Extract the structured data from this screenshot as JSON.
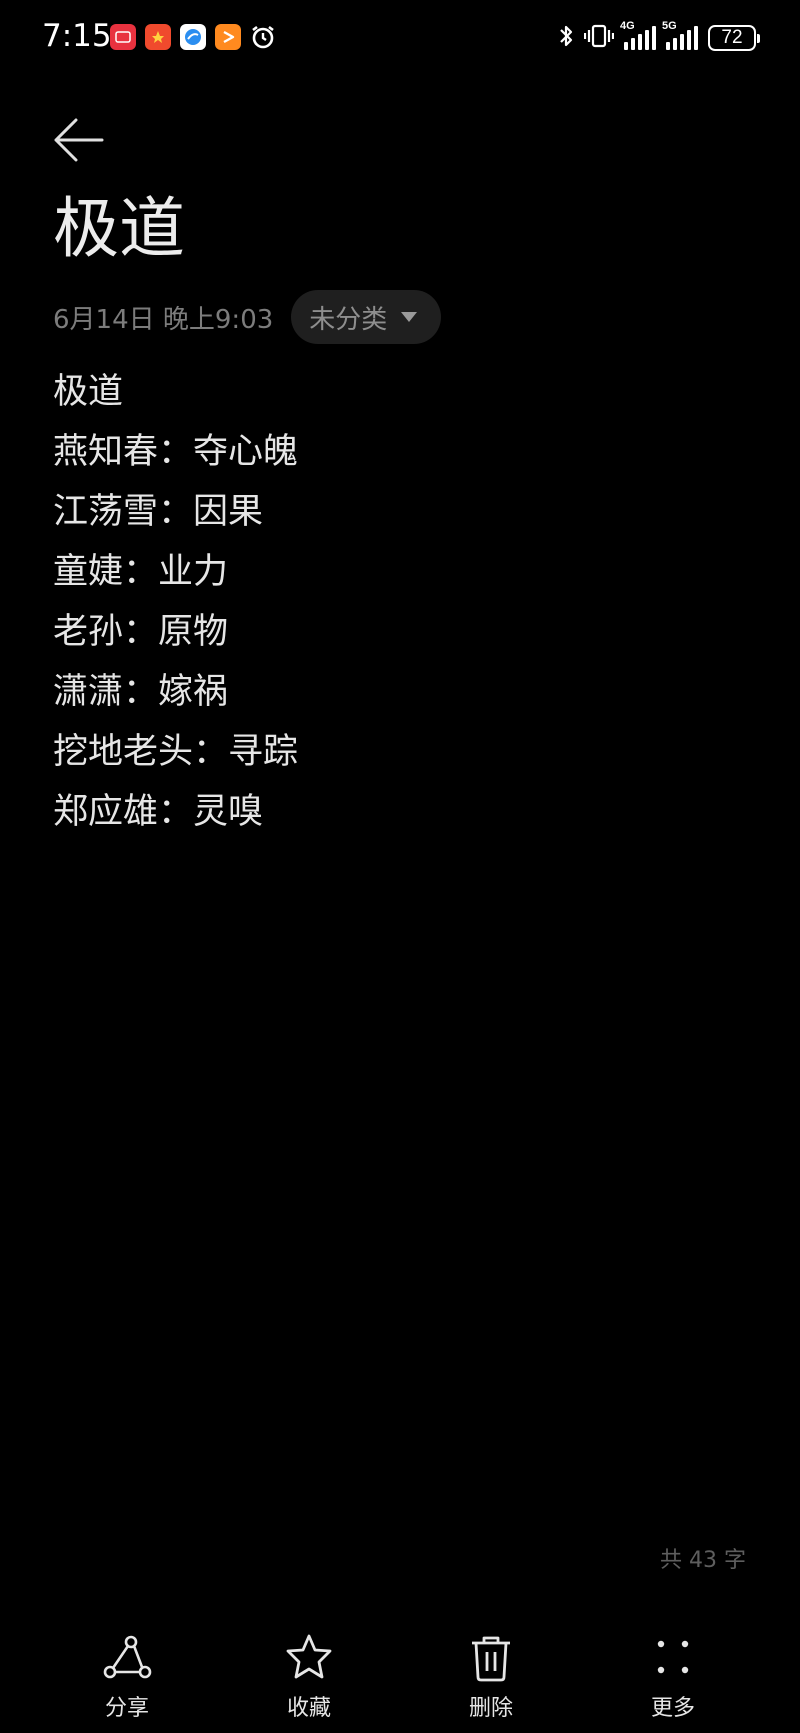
{
  "status_bar": {
    "time": "7:15",
    "battery": "72",
    "network_1": "4G",
    "network_2": "5G"
  },
  "note": {
    "title": "极道",
    "date": "6月14日 晚上9:03",
    "category": "未分类",
    "lines": [
      "极道",
      "燕知春：夺心魄",
      "江荡雪：因果",
      "童婕：业力",
      "老孙：原物",
      "潇潇：嫁祸",
      "挖地老头：寻踪",
      "郑应雄：灵嗅"
    ],
    "word_count": "共 43 字"
  },
  "toolbar": {
    "share": "分享",
    "favorite": "收藏",
    "delete": "删除",
    "more": "更多"
  },
  "colors": {
    "background": "#000000",
    "text": "#e6e6e6",
    "muted": "#7c7c7c",
    "chip": "#1f1f1f"
  }
}
